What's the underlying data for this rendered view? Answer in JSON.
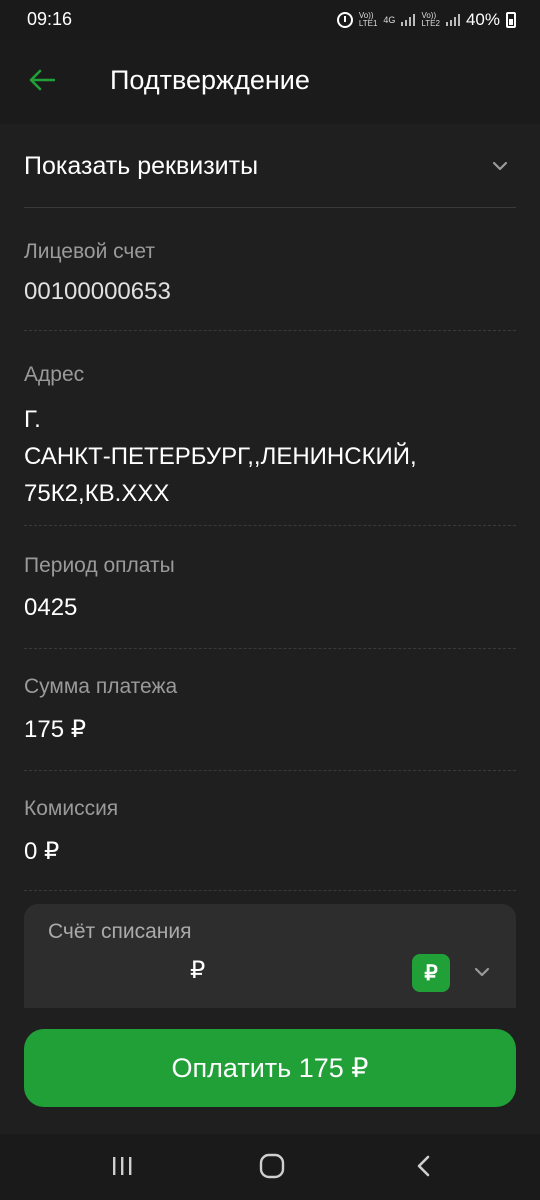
{
  "status": {
    "time": "09:16",
    "battery": "40%",
    "sim1_top": "Vo))",
    "sim1_bottom": "LTE1",
    "sim1_type": "4G",
    "sim2_top": "Vo))",
    "sim2_bottom": "LTE2"
  },
  "header": {
    "title": "Подтверждение"
  },
  "requisites": {
    "label": "Показать реквизиты"
  },
  "fields": {
    "account": {
      "label": "Лицевой счет",
      "value": "00100000653"
    },
    "address": {
      "label": "Адрес",
      "line1": "Г.",
      "line2": "САНКТ-ПЕТЕРБУРГ,,ЛЕНИНСКИЙ,",
      "line3": "75К2,КВ.ХХХ"
    },
    "period": {
      "label": "Период оплаты",
      "value": "0425"
    },
    "amount": {
      "label": "Сумма платежа",
      "value": "175 ₽"
    },
    "commission": {
      "label": "Комиссия",
      "value": "0 ₽"
    }
  },
  "debit": {
    "title": "Счёт списания",
    "currency": "₽",
    "badge": "₽"
  },
  "pay_button": {
    "label": "Оплатить 175 ₽"
  },
  "colors": {
    "accent": "#21a038",
    "background": "#1f1f1f",
    "label": "#9a9a9a"
  },
  "icons": [
    "back-arrow-icon",
    "chevron-down-icon",
    "ruble-icon",
    "recents-icon",
    "home-icon",
    "back-icon"
  ]
}
